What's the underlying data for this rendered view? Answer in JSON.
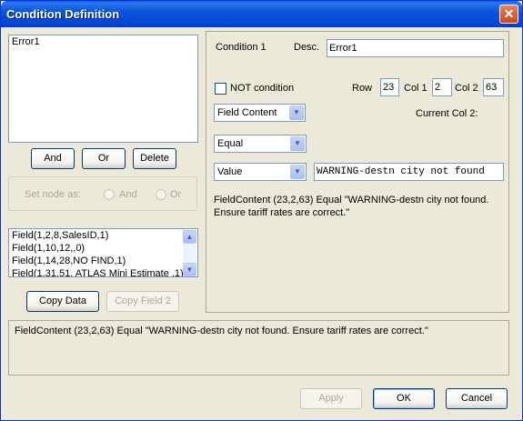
{
  "window": {
    "title": "Condition Definition",
    "close_glyph": "✕"
  },
  "tree": {
    "items": [
      "Error1"
    ]
  },
  "node_buttons": {
    "and": "And",
    "or": "Or",
    "delete": "Delete"
  },
  "set_node": {
    "label": "Set node as:",
    "and": "And",
    "or": "Or"
  },
  "fields_list": {
    "items": [
      "Field(1,2,8,SalesID,1)",
      "Field(1,10,12,,0)",
      "Field(1,14,28,NO FIND,1)",
      "Field(1,31,51, ATLAS Mini Estimate ,1)"
    ],
    "scroll_up": "▲",
    "scroll_down": "▼"
  },
  "copy_buttons": {
    "copy_data": "Copy Data",
    "copy_field2": "Copy Field 2"
  },
  "condition": {
    "name": "Condition 1",
    "desc_label": "Desc.",
    "desc_value": "Error1",
    "not_label": "NOT condition",
    "row_label": "Row",
    "row_value": "23",
    "col1_label": "Col 1",
    "col1_value": "2",
    "col2_label": "Col 2",
    "col2_value": "63",
    "current_col2_label": "Current Col 2:",
    "type_select": "Field Content",
    "operator_select": "Equal",
    "value_type_select": "Value",
    "value_input": "WARNING-destn city not found",
    "summary": "FieldContent (23,2,63) Equal \"WARNING-destn city not found. Ensure tariff rates are correct.\"",
    "dropdown_arrow": "▼"
  },
  "expression": "FieldContent (23,2,63) Equal \"WARNING-destn city not found. Ensure tariff rates are correct.\"",
  "footer": {
    "apply": "Apply",
    "ok": "OK",
    "cancel": "Cancel"
  }
}
